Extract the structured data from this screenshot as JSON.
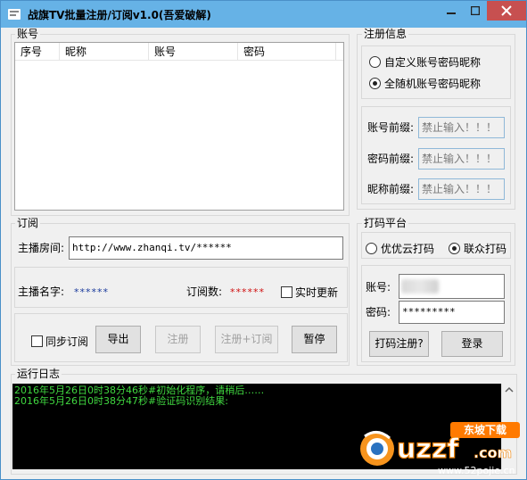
{
  "window": {
    "title": "战旗TV批量注册/订阅v1.0(吾爱破解)"
  },
  "accounts": {
    "group_label": "账号",
    "columns": [
      "序号",
      "昵称",
      "账号",
      "密码"
    ]
  },
  "register_info": {
    "group_label": "注册信息",
    "options": [
      {
        "label": "自定义账号密码昵称",
        "selected": false
      },
      {
        "label": "全随机账号密码昵称",
        "selected": true
      }
    ],
    "fields": [
      {
        "label": "账号前缀:",
        "value": "禁止输入！！！"
      },
      {
        "label": "密码前缀:",
        "value": "禁止输入！！！"
      },
      {
        "label": "昵称前缀:",
        "value": "禁止输入！！！"
      }
    ]
  },
  "subscribe": {
    "group_label": "订阅",
    "room_label": "主播房间:",
    "room_value": "http://www.zhanqi.tv/******",
    "anchor_label": "主播名字:",
    "anchor_value": "******",
    "sub_count_label": "订阅数:",
    "sub_count_value": "******",
    "realtime_label": "实时更新",
    "sync_label": "同步订阅",
    "export_label": "导出",
    "register_label": "注册",
    "register_sub_label": "注册+订阅",
    "pause_label": "暂停"
  },
  "captcha": {
    "group_label": "打码平台",
    "options": [
      {
        "label": "优优云打码",
        "selected": false
      },
      {
        "label": "联众打码",
        "selected": true
      }
    ],
    "account_label": "账号:",
    "password_label": "密码:",
    "password_value": "*********",
    "register_btn": "打码注册?",
    "login_btn": "登录"
  },
  "log": {
    "group_label": "运行日志",
    "lines": [
      "2016年5月26日0时38分46秒#初始化程序，请稍后……",
      "2016年5月26日0时38分47秒#验证码识别结果:"
    ]
  },
  "watermark": {
    "brand": "uzzf",
    "suffix": ".com",
    "tag": "东坡下载",
    "site": "www.52pojie.cn"
  },
  "colors": {
    "titlebar": "#66b2e6",
    "close": "#c75050",
    "log_text": "#40d840",
    "anchor_value": "#1a3a9c",
    "sub_count_value": "#d01010"
  }
}
